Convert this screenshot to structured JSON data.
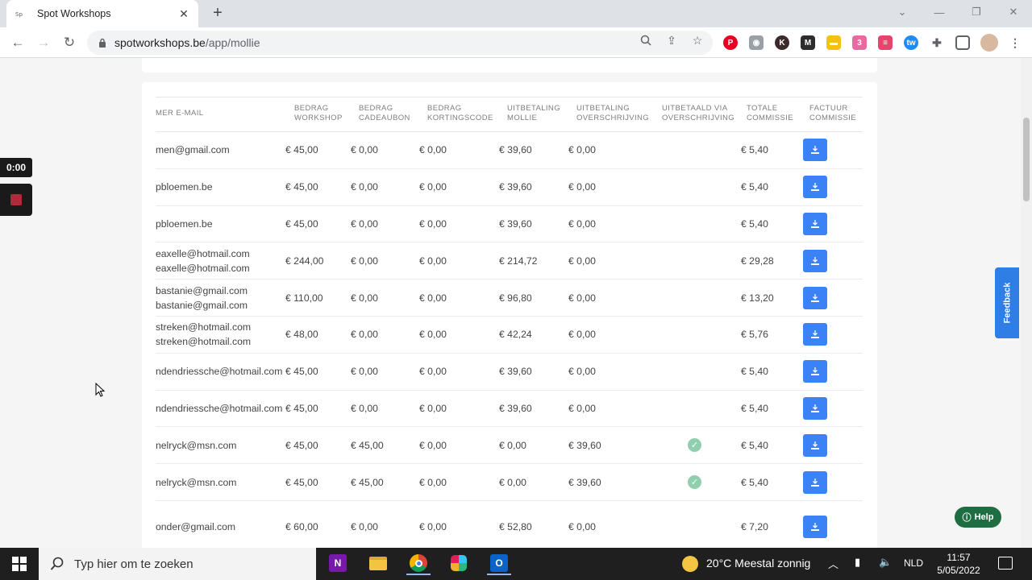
{
  "browser": {
    "tab_title": "Spot Workshops",
    "tab_favicon": "spot-favicon-icon",
    "new_tab": "+",
    "url_domain": "spotworkshops.be",
    "url_path": "/app/mollie"
  },
  "extensions": [
    "pinterest-icon",
    "camera-icon",
    "k-extension-icon",
    "m-extension-icon",
    "yellow-extension-icon",
    "multi-extension-icon",
    "stack-extension-icon",
    "tw-extension-icon",
    "puzzle-icon",
    "sidepanel-icon",
    "profile-avatar"
  ],
  "recorder": {
    "time": "0:00"
  },
  "table": {
    "headers": [
      [
        "MER E-MAIL"
      ],
      [
        "BEDRAG",
        "WORKSHOP"
      ],
      [
        "BEDRAG",
        "CADEAUBON"
      ],
      [
        "BEDRAG",
        "KORTINGSCODE"
      ],
      [
        "UITBETALING",
        "MOLLIE"
      ],
      [
        "UITBETALING",
        "OVERSCHRIJVING"
      ],
      [
        "UITBETAALD VIA",
        "OVERSCHRIJVING"
      ],
      [
        "TOTALE",
        "COMMISSIE"
      ],
      [
        "FACTUUR",
        "COMMISSIE"
      ]
    ],
    "rows": [
      {
        "email": [
          "men@gmail.com"
        ],
        "workshop": "€ 45,00",
        "cadeaubon": "€ 0,00",
        "korting": "€ 0,00",
        "mollie": "€ 39,60",
        "overschrijving": "€ 0,00",
        "paid": false,
        "commissie": "€ 5,40"
      },
      {
        "email": [
          "pbloemen.be"
        ],
        "workshop": "€ 45,00",
        "cadeaubon": "€ 0,00",
        "korting": "€ 0,00",
        "mollie": "€ 39,60",
        "overschrijving": "€ 0,00",
        "paid": false,
        "commissie": "€ 5,40"
      },
      {
        "email": [
          "pbloemen.be"
        ],
        "workshop": "€ 45,00",
        "cadeaubon": "€ 0,00",
        "korting": "€ 0,00",
        "mollie": "€ 39,60",
        "overschrijving": "€ 0,00",
        "paid": false,
        "commissie": "€ 5,40"
      },
      {
        "email": [
          "eaxelle@hotmail.com",
          "eaxelle@hotmail.com"
        ],
        "workshop": "€ 244,00",
        "cadeaubon": "€ 0,00",
        "korting": "€ 0,00",
        "mollie": "€ 214,72",
        "overschrijving": "€ 0,00",
        "paid": false,
        "commissie": "€ 29,28"
      },
      {
        "email": [
          "bastanie@gmail.com",
          "bastanie@gmail.com"
        ],
        "workshop": "€ 110,00",
        "cadeaubon": "€ 0,00",
        "korting": "€ 0,00",
        "mollie": "€ 96,80",
        "overschrijving": "€ 0,00",
        "paid": false,
        "commissie": "€ 13,20"
      },
      {
        "email": [
          "streken@hotmail.com",
          "streken@hotmail.com"
        ],
        "workshop": "€ 48,00",
        "cadeaubon": "€ 0,00",
        "korting": "€ 0,00",
        "mollie": "€ 42,24",
        "overschrijving": "€ 0,00",
        "paid": false,
        "commissie": "€ 5,76"
      },
      {
        "email": [
          "ndendriessche@hotmail.com"
        ],
        "workshop": "€ 45,00",
        "cadeaubon": "€ 0,00",
        "korting": "€ 0,00",
        "mollie": "€ 39,60",
        "overschrijving": "€ 0,00",
        "paid": false,
        "commissie": "€ 5,40"
      },
      {
        "email": [
          "ndendriessche@hotmail.com"
        ],
        "workshop": "€ 45,00",
        "cadeaubon": "€ 0,00",
        "korting": "€ 0,00",
        "mollie": "€ 39,60",
        "overschrijving": "€ 0,00",
        "paid": false,
        "commissie": "€ 5,40"
      },
      {
        "email": [
          "nelryck@msn.com"
        ],
        "workshop": "€ 45,00",
        "cadeaubon": "€ 45,00",
        "korting": "€ 0,00",
        "mollie": "€ 0,00",
        "overschrijving": "€ 39,60",
        "paid": true,
        "commissie": "€ 5,40"
      },
      {
        "email": [
          "nelryck@msn.com"
        ],
        "workshop": "€ 45,00",
        "cadeaubon": "€ 45,00",
        "korting": "€ 0,00",
        "mollie": "€ 0,00",
        "overschrijving": "€ 39,60",
        "paid": true,
        "commissie": "€ 5,40"
      },
      {
        "email": [
          "onder@gmail.com"
        ],
        "workshop": "€ 60,00",
        "cadeaubon": "€ 0,00",
        "korting": "€ 0,00",
        "mollie": "€ 52,80",
        "overschrijving": "€ 0,00",
        "paid": false,
        "commissie": "€ 7,20"
      }
    ]
  },
  "feedback_label": "Feedback",
  "help_label": "Help",
  "taskbar": {
    "search_placeholder": "Typ hier om te zoeken",
    "weather": "20°C  Meestal zonnig",
    "language": "NLD",
    "time": "11:57",
    "date": "5/05/2022"
  },
  "colors": {
    "accent_blue": "#3b82f6",
    "help_green": "#1f6e43",
    "check_green": "#8fcfae"
  }
}
